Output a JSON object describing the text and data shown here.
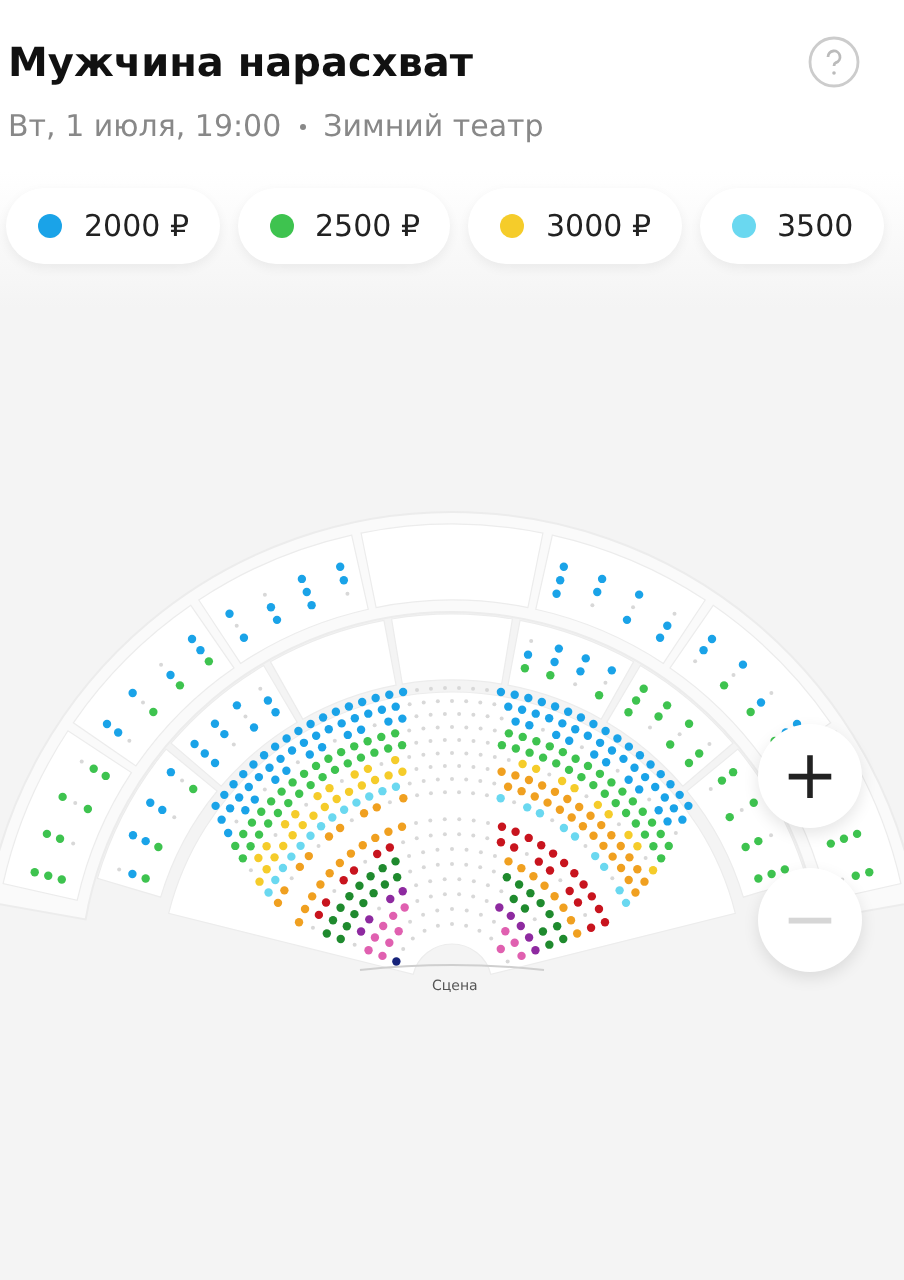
{
  "event": {
    "title": "Мужчина нарасхват",
    "datetime": "Вт, 1 июля, 19:00",
    "venue": "Зимний театр"
  },
  "prices": [
    {
      "label": "2000 ₽",
      "color": "#1aa3e8"
    },
    {
      "label": "2500 ₽",
      "color": "#3ec34f"
    },
    {
      "label": "3000 ₽",
      "color": "#f5cc2a"
    },
    {
      "label": "3500",
      "color": "#6ad8f0"
    }
  ],
  "map": {
    "stage_label": "Сцена"
  },
  "zoom_in": {
    "label": "+",
    "disabled": false
  },
  "zoom_out": {
    "label": "−",
    "disabled": true
  }
}
